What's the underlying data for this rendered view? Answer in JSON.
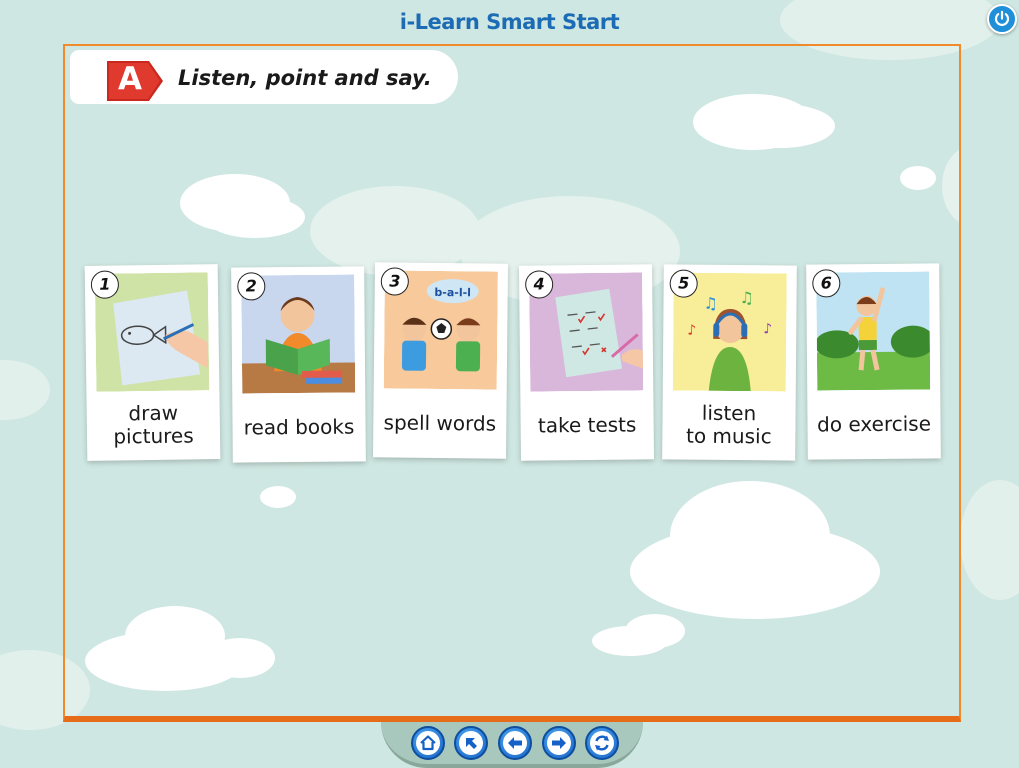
{
  "app": {
    "title": "i-Learn Smart Start"
  },
  "exercise": {
    "letter": "A",
    "instruction": "Listen, point and say."
  },
  "cards": [
    {
      "number": "1",
      "caption": "draw\npictures",
      "picture": "hand-drawing-fish"
    },
    {
      "number": "2",
      "caption": "read books",
      "picture": "boy-reading-book"
    },
    {
      "number": "3",
      "caption": "spell words",
      "picture": "boys-spelling-ball",
      "bubble_text": "b-a-l-l"
    },
    {
      "number": "4",
      "caption": "take tests",
      "picture": "test-paper-with-pen"
    },
    {
      "number": "5",
      "caption": "listen\nto music",
      "picture": "girl-with-headphones"
    },
    {
      "number": "6",
      "caption": "do exercise",
      "picture": "boy-stretching-outdoors"
    }
  ],
  "navigation": {
    "buttons": [
      {
        "name": "home",
        "icon": "home-icon"
      },
      {
        "name": "back-to-menu",
        "icon": "arrow-up-left-icon"
      },
      {
        "name": "previous",
        "icon": "arrow-left-icon"
      },
      {
        "name": "next",
        "icon": "arrow-right-icon"
      },
      {
        "name": "replay",
        "icon": "refresh-icon"
      }
    ]
  },
  "colors": {
    "background": "#cfe7e2",
    "title": "#1c6bb5",
    "frame_border": "#f08a2a",
    "badge": "#d8332a",
    "nav_button": "#1561c8"
  }
}
